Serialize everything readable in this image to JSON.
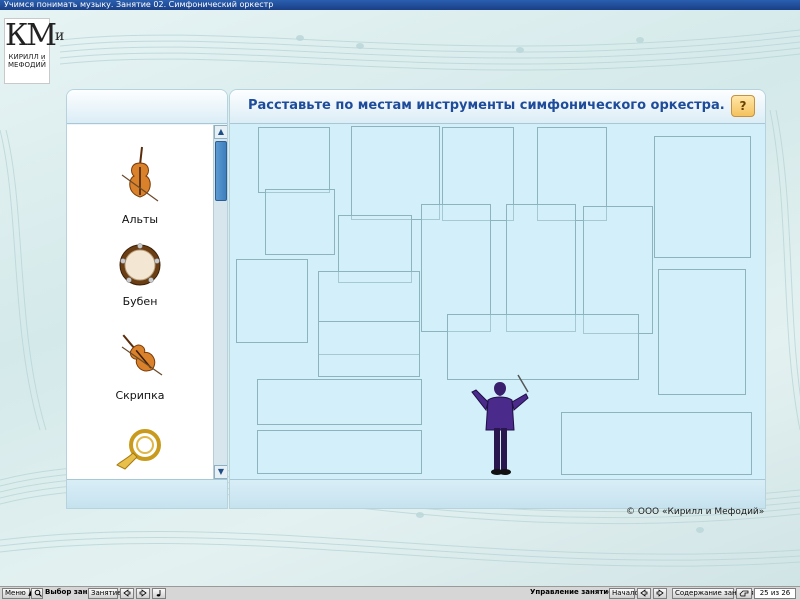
{
  "window": {
    "title": "Учимся понимать музыку. Занятие 02. Симфонический оркестр"
  },
  "logo": {
    "letters": "КМ",
    "superscript": "и",
    "line1": "КИРИЛЛ и",
    "line2": "МЕФОДИЙ"
  },
  "instruments": [
    {
      "label": "Альты",
      "icon": "viola-icon"
    },
    {
      "label": "Бубен",
      "icon": "tambourine-icon"
    },
    {
      "label": "Скрипка",
      "icon": "violin-icon"
    },
    {
      "label": "",
      "icon": "french-horn-icon"
    }
  ],
  "scrollbar": {
    "up": "▲",
    "down": "▼"
  },
  "task": {
    "title": "Расставьте по местам инструменты симфонического оркестра.",
    "help_label": "?"
  },
  "copyright": "© ООО «Кирилл и Мефодий»",
  "toolbar": {
    "menu_label": "Меню",
    "menu_arrow": "▲",
    "select_lesson_label": "Выбор занятия:",
    "lesson_button": "Занятие",
    "manage_label": "Управление занятием:",
    "start_button": "Начало",
    "contents_button": "Содержание занятия",
    "page_counter": "25 из 26"
  },
  "colors": {
    "title_text": "#1e4c9a",
    "stage_bg": "#d3f0fa",
    "titlebar": "#1a3f86",
    "help_button": "#f5c25d"
  }
}
